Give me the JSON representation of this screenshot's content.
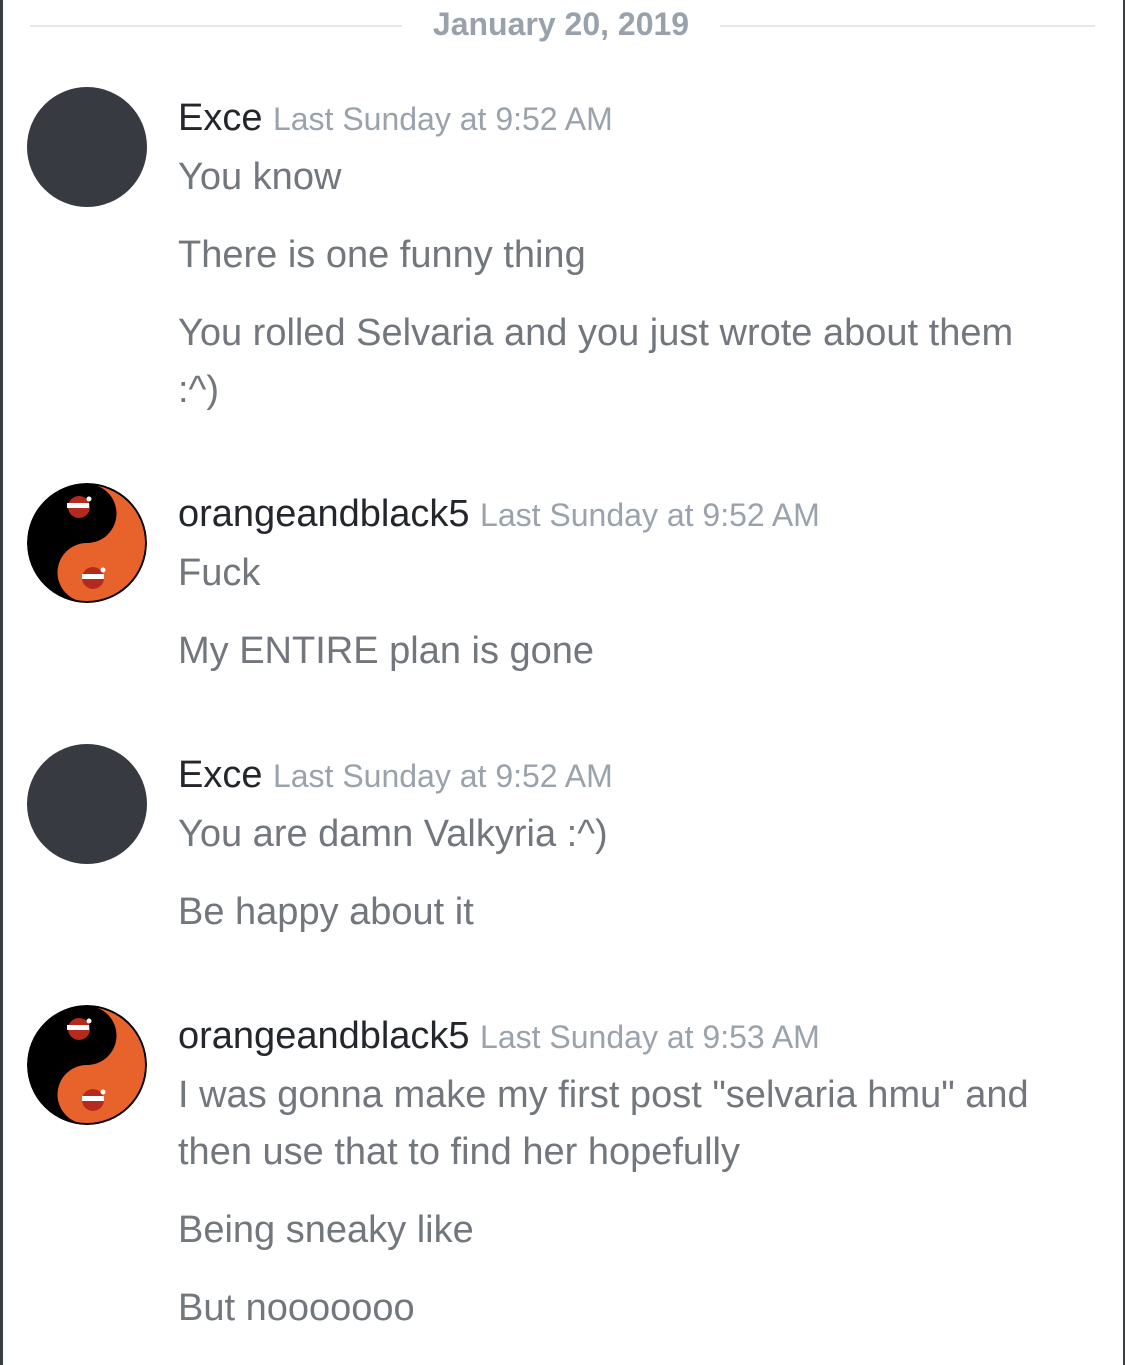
{
  "date_divider": "January 20, 2019",
  "messages": [
    {
      "username": "Exce",
      "timestamp": "Last Sunday at 9:52 AM",
      "avatar": "dark-circle-avatar",
      "lines": [
        "You know",
        "There is one funny thing",
        "You rolled Selvaria and you just wrote about them :^)"
      ]
    },
    {
      "username": "orangeandblack5",
      "timestamp": "Last Sunday at 9:52 AM",
      "avatar": "yin-yang-santa-avatar",
      "lines": [
        "Fuck",
        "My ENTIRE plan is gone"
      ]
    },
    {
      "username": "Exce",
      "timestamp": "Last Sunday at 9:52 AM",
      "avatar": "dark-circle-avatar",
      "lines": [
        "You are damn Valkyria :^)",
        "Be happy about it"
      ]
    },
    {
      "username": "orangeandblack5",
      "timestamp": "Last Sunday at 9:53 AM",
      "avatar": "yin-yang-santa-avatar",
      "lines": [
        "I was gonna make my first post \"selvaria hmu\" and then use that to find her hopefully",
        "Being sneaky like",
        "But nooooooo"
      ]
    }
  ],
  "colors": {
    "username": "#23262b",
    "timestamp": "#9aa2ac",
    "message_text": "#72767d",
    "divider_text": "#99a1ab",
    "avatar_dark": "#373a41",
    "avatar_orange": "#e8632b"
  }
}
